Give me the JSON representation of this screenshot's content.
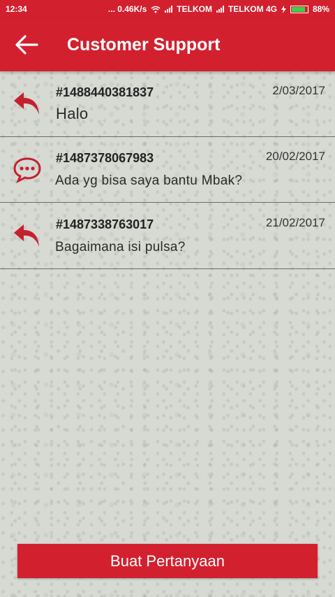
{
  "status_bar": {
    "time": "12:34",
    "speed": "... 0.46K/s",
    "carrier1": "TELKOM",
    "carrier2": "TELKOM 4G",
    "battery": "88%",
    "battery_level": 0.88
  },
  "app_bar": {
    "title": "Customer Support",
    "back_icon": "arrow-left-icon"
  },
  "tickets": [
    {
      "id": "#1488440381837",
      "date": "2/03/2017",
      "message": "Halo",
      "icon": "reply-icon"
    },
    {
      "id": "#1487378067983",
      "date": "20/02/2017",
      "message": "Ada yg bisa saya bantu Mbak?",
      "icon": "chat-bubble-icon"
    },
    {
      "id": "#1487338763017",
      "date": "21/02/2017",
      "message": "Bagaimana isi pulsa?",
      "icon": "reply-icon"
    }
  ],
  "create_button": {
    "label": "Buat Pertanyaan"
  },
  "colors": {
    "primary": "#d2202f",
    "background": "#d7d9d3"
  }
}
